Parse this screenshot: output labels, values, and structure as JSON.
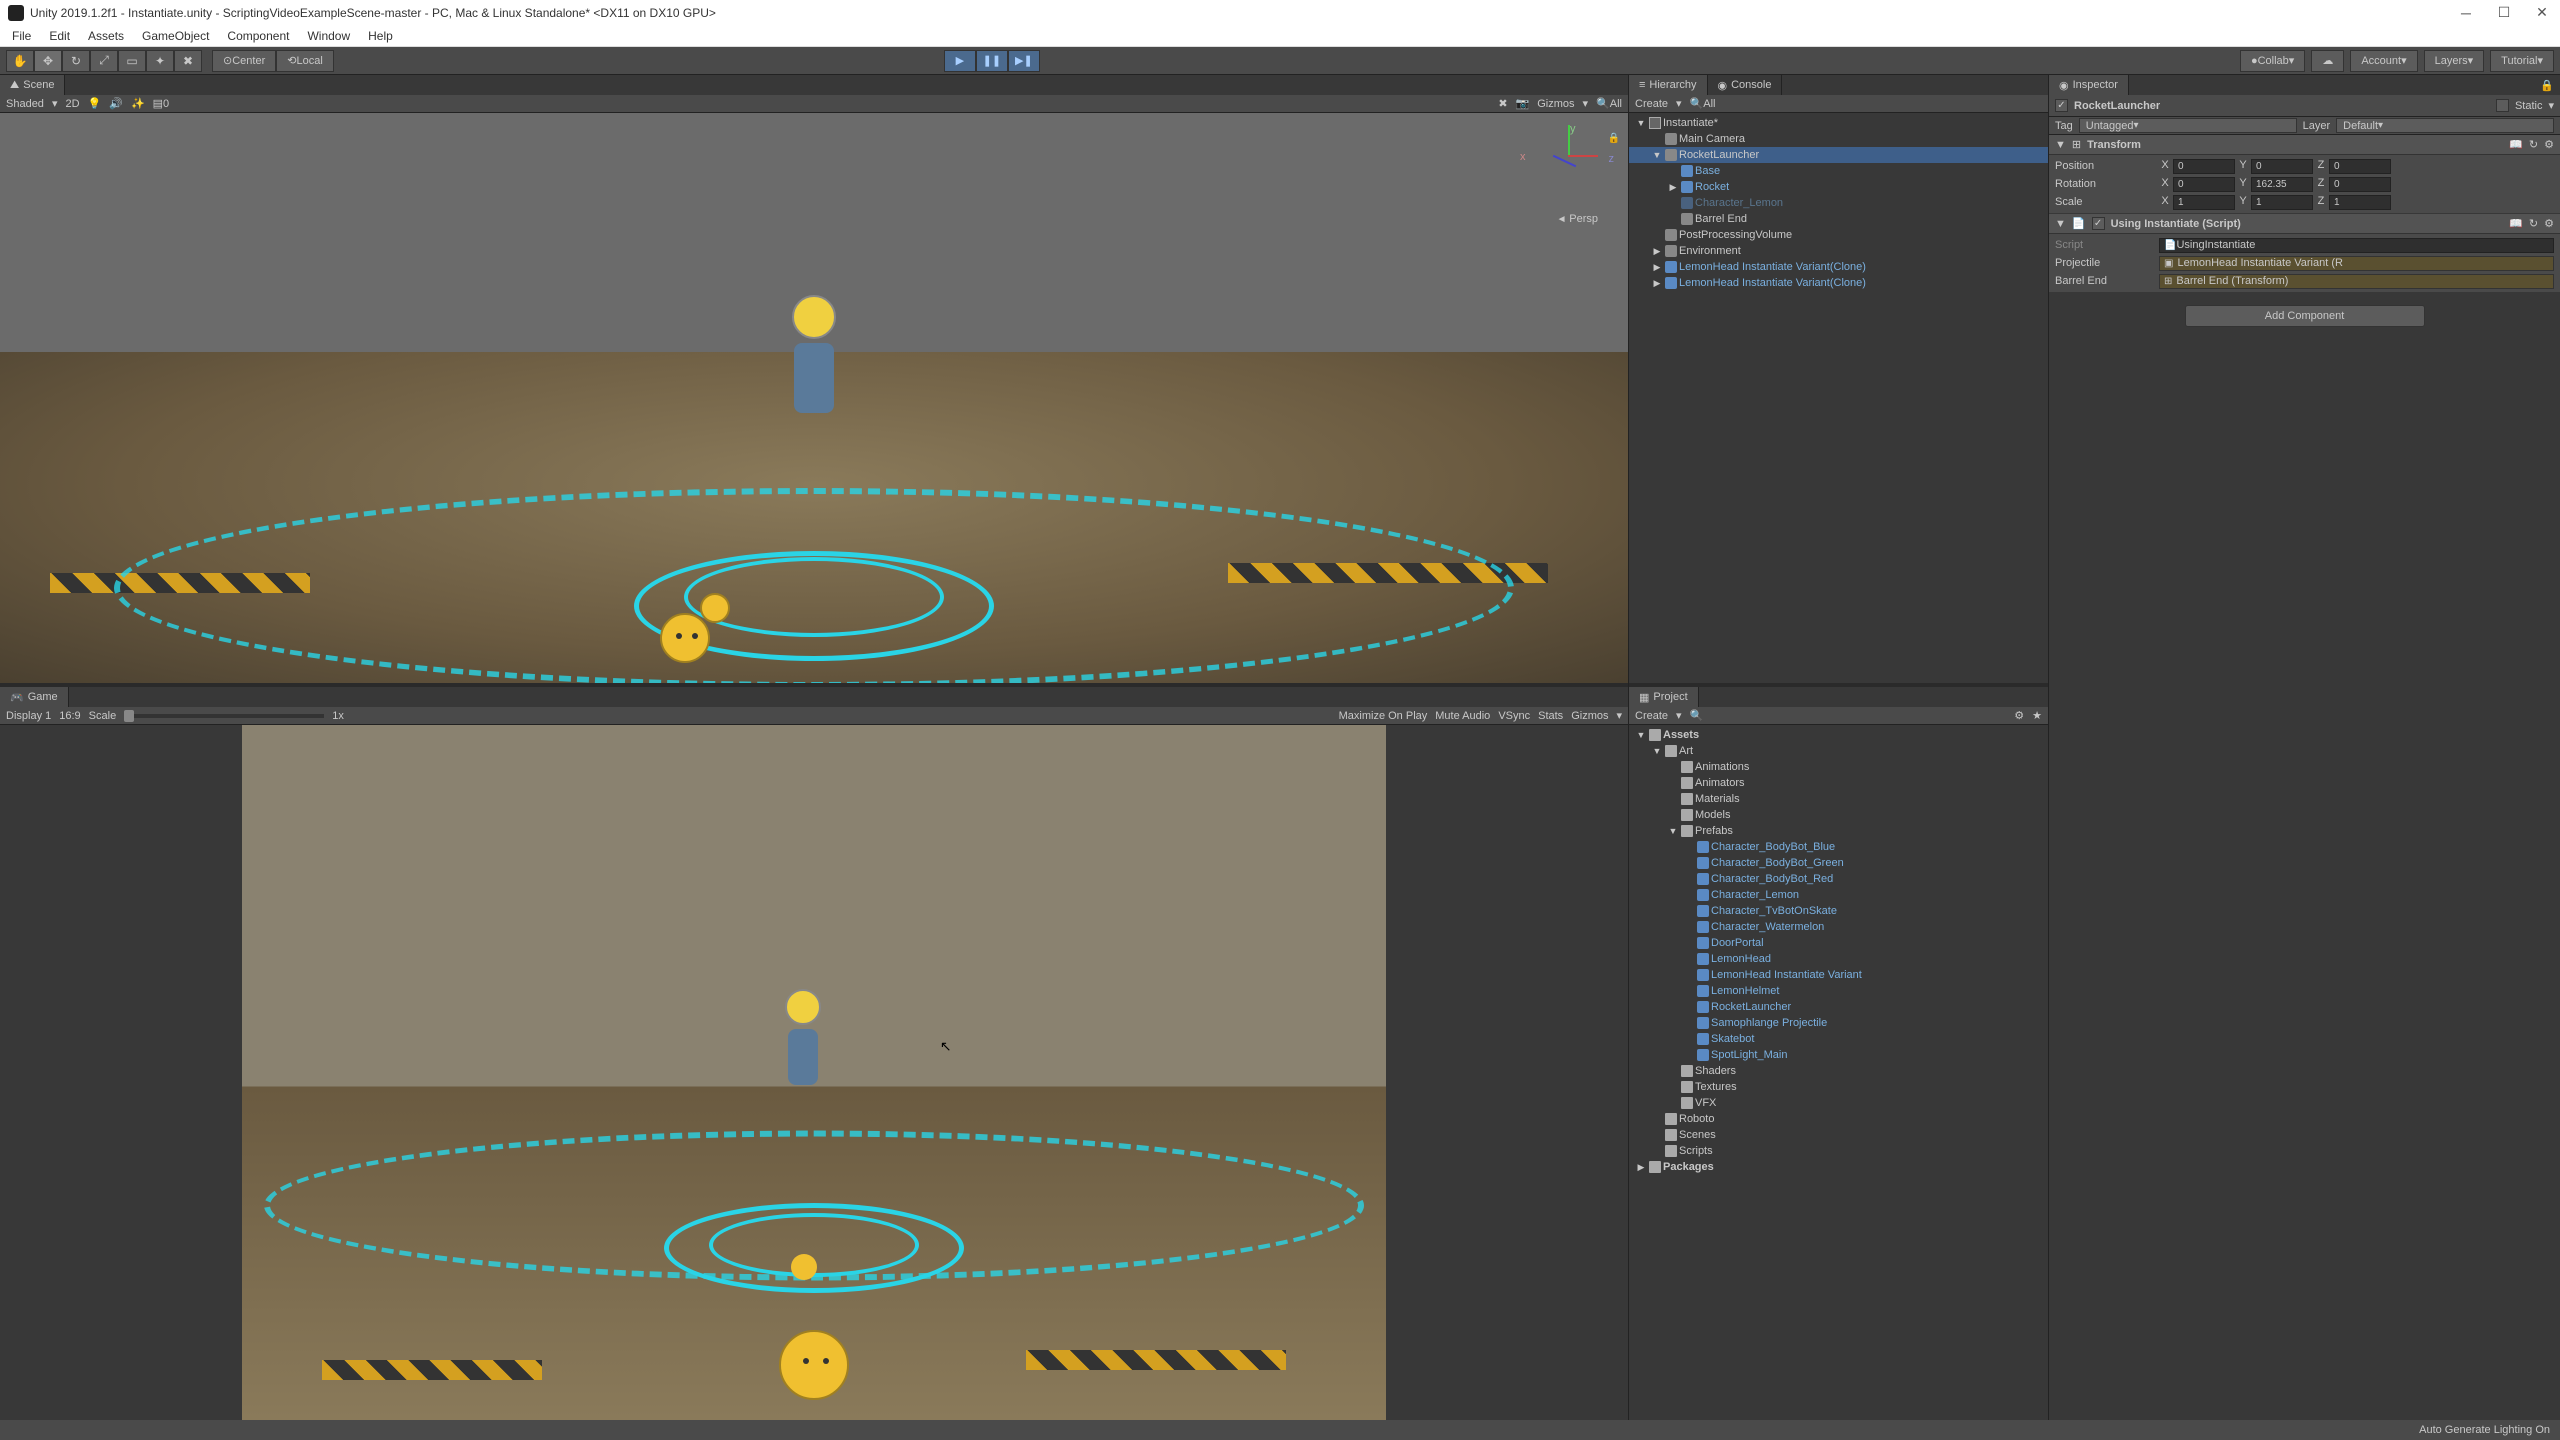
{
  "titlebar": "Unity 2019.1.2f1 - Instantiate.unity - ScriptingVideoExampleScene-master - PC, Mac & Linux Standalone* <DX11 on DX10 GPU>",
  "menubar": [
    "File",
    "Edit",
    "Assets",
    "GameObject",
    "Component",
    "Window",
    "Help"
  ],
  "toolbar": {
    "pivot": "Center",
    "local": "Local",
    "collab": "Collab",
    "account": "Account",
    "layers": "Layers",
    "layout": "Tutorial"
  },
  "scene": {
    "tab": "Scene",
    "shaded": "Shaded",
    "mode2d": "2D",
    "gizmos": "Gizmos",
    "all": "All",
    "persp": "Persp",
    "axis": {
      "x": "x",
      "y": "y",
      "z": "z"
    }
  },
  "game": {
    "tab": "Game",
    "display": "Display 1",
    "aspect": "16:9",
    "scale": "Scale",
    "scaleVal": "1x",
    "maximize": "Maximize On Play",
    "mute": "Mute Audio",
    "vsync": "VSync",
    "stats": "Stats",
    "gizmos": "Gizmos"
  },
  "hierarchy": {
    "tab": "Hierarchy",
    "console": "Console",
    "create": "Create",
    "all": "All",
    "items": [
      {
        "name": "Instantiate*",
        "depth": 0,
        "fold": "▼",
        "type": "scene"
      },
      {
        "name": "Main Camera",
        "depth": 1,
        "type": "go"
      },
      {
        "name": "RocketLauncher",
        "depth": 1,
        "fold": "▼",
        "type": "go",
        "selected": true
      },
      {
        "name": "Base",
        "depth": 2,
        "type": "prefab"
      },
      {
        "name": "Rocket",
        "depth": 2,
        "fold": "▶",
        "type": "prefab"
      },
      {
        "name": "Character_Lemon",
        "depth": 2,
        "type": "prefab",
        "dim": true
      },
      {
        "name": "Barrel End",
        "depth": 2,
        "type": "go"
      },
      {
        "name": "PostProcessingVolume",
        "depth": 1,
        "type": "go"
      },
      {
        "name": "Environment",
        "depth": 1,
        "fold": "▶",
        "type": "go"
      },
      {
        "name": "LemonHead Instantiate Variant(Clone)",
        "depth": 1,
        "fold": "▶",
        "type": "prefab"
      },
      {
        "name": "LemonHead Instantiate Variant(Clone)",
        "depth": 1,
        "fold": "▶",
        "type": "prefab"
      }
    ]
  },
  "project": {
    "tab": "Project",
    "create": "Create",
    "items": [
      {
        "name": "Assets",
        "depth": 0,
        "fold": "▼",
        "bold": true
      },
      {
        "name": "Art",
        "depth": 1,
        "fold": "▼"
      },
      {
        "name": "Animations",
        "depth": 2
      },
      {
        "name": "Animators",
        "depth": 2
      },
      {
        "name": "Materials",
        "depth": 2
      },
      {
        "name": "Models",
        "depth": 2
      },
      {
        "name": "Prefabs",
        "depth": 2,
        "fold": "▼"
      },
      {
        "name": "Character_BodyBot_Blue",
        "depth": 3,
        "type": "prefab"
      },
      {
        "name": "Character_BodyBot_Green",
        "depth": 3,
        "type": "prefab"
      },
      {
        "name": "Character_BodyBot_Red",
        "depth": 3,
        "type": "prefab"
      },
      {
        "name": "Character_Lemon",
        "depth": 3,
        "type": "prefab"
      },
      {
        "name": "Character_TvBotOnSkate",
        "depth": 3,
        "type": "prefab"
      },
      {
        "name": "Character_Watermelon",
        "depth": 3,
        "type": "prefab"
      },
      {
        "name": "DoorPortal",
        "depth": 3,
        "type": "prefab"
      },
      {
        "name": "LemonHead",
        "depth": 3,
        "type": "prefab"
      },
      {
        "name": "LemonHead Instantiate Variant",
        "depth": 3,
        "type": "prefab"
      },
      {
        "name": "LemonHelmet",
        "depth": 3,
        "type": "prefab"
      },
      {
        "name": "RocketLauncher",
        "depth": 3,
        "type": "prefab"
      },
      {
        "name": "Samophlange Projectile",
        "depth": 3,
        "type": "prefab"
      },
      {
        "name": "Skatebot",
        "depth": 3,
        "type": "prefab"
      },
      {
        "name": "SpotLight_Main",
        "depth": 3,
        "type": "prefab"
      },
      {
        "name": "Shaders",
        "depth": 2
      },
      {
        "name": "Textures",
        "depth": 2
      },
      {
        "name": "VFX",
        "depth": 2
      },
      {
        "name": "Roboto",
        "depth": 1
      },
      {
        "name": "Scenes",
        "depth": 1
      },
      {
        "name": "Scripts",
        "depth": 1
      },
      {
        "name": "Packages",
        "depth": 0,
        "fold": "▶",
        "bold": true
      }
    ]
  },
  "inspector": {
    "tab": "Inspector",
    "name": "RocketLauncher",
    "static": "Static",
    "tag": "Tag",
    "tagVal": "Untagged",
    "layer": "Layer",
    "layerVal": "Default",
    "transform": {
      "title": "Transform",
      "position": {
        "label": "Position",
        "x": "0",
        "y": "0",
        "z": "0"
      },
      "rotation": {
        "label": "Rotation",
        "x": "0",
        "y": "162.35",
        "z": "0"
      },
      "scale": {
        "label": "Scale",
        "x": "1",
        "y": "1",
        "z": "1"
      }
    },
    "script": {
      "title": "Using Instantiate (Script)",
      "scriptLabel": "Script",
      "scriptVal": "UsingInstantiate",
      "projectileLabel": "Projectile",
      "projectileVal": "LemonHead Instantiate Variant (R",
      "barrelLabel": "Barrel End",
      "barrelVal": "Barrel End (Transform)"
    },
    "addComp": "Add Component"
  },
  "statusbar": "Auto Generate Lighting On"
}
